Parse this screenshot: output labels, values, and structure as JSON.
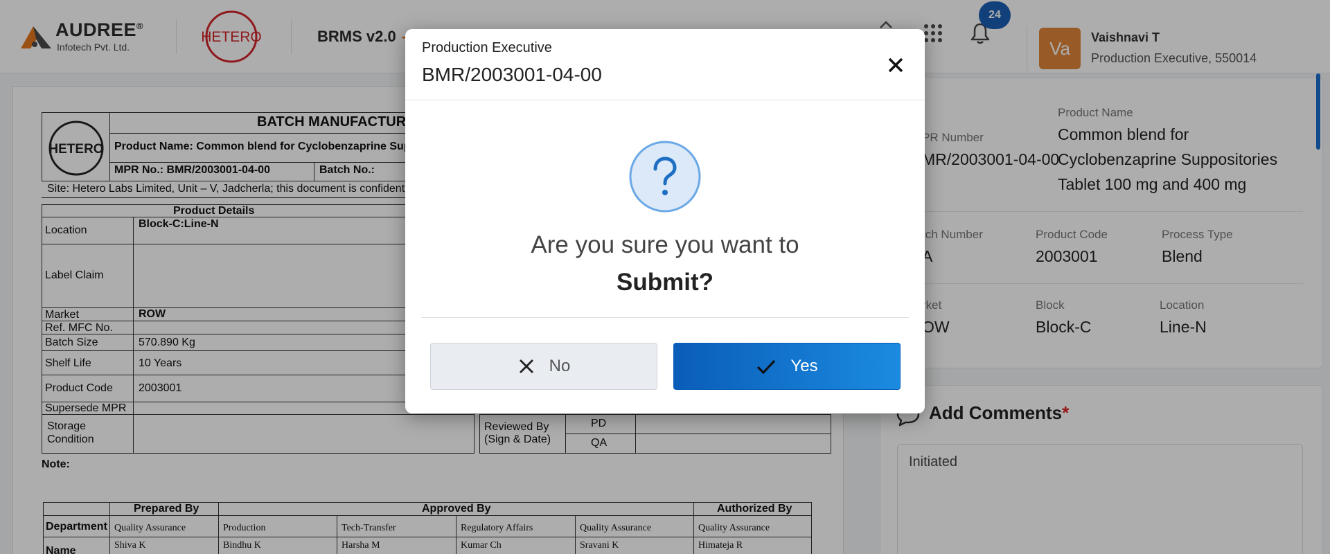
{
  "header": {
    "company_name": "AUDREE",
    "company_reg": "®",
    "company_sub": "Infotech Pvt. Ltd.",
    "client_logo_text": "HETERO",
    "app_title": "BRMS v2.0",
    "app_title_suffix": "-",
    "notification_count": "24",
    "user": {
      "initials": "Va",
      "name": "Vaishnavi T",
      "role": "Production Executive, 550014"
    },
    "icons": [
      "chevron-up-icon",
      "apps-grid-icon",
      "bell-icon"
    ]
  },
  "document": {
    "logo_text": "HETERO",
    "title": "BATCH MANUFACTUR",
    "product_name": "Product Name: Common blend for Cyclobenzaprine Sup",
    "mpr_no": "MPR No.: BMR/2003001-04-00",
    "batch_no": "Batch No.:",
    "site": "Site: Hetero Labs Limited, Unit – V, Jadcherla; this document is confidentia",
    "details_heading": "Product Details",
    "rows": [
      {
        "label": "Location",
        "value": "Block-C:Line-N"
      },
      {
        "label": "Label Claim",
        "value": ""
      },
      {
        "label": "Market",
        "value": "ROW"
      },
      {
        "label": "Ref. MFC No.",
        "value": ""
      },
      {
        "label": "Batch Size",
        "value": "570.890 Kg"
      },
      {
        "label": "Shelf Life",
        "value": "10 Years"
      },
      {
        "label": "Product Code",
        "value": "2003001"
      },
      {
        "label": "Supersede MPR",
        "value": ""
      },
      {
        "label": "Storage",
        "value": ""
      },
      {
        "label": "Condition",
        "value": ""
      }
    ],
    "reviewed_by_line1": "Reviewed By",
    "reviewed_by_line2": "(Sign & Date)",
    "review_pd": "PD",
    "review_qa": "QA",
    "note": "Note:",
    "approvals": {
      "prepared_by": "Prepared By",
      "approved_by": "Approved By",
      "authorized_by": "Authorized By",
      "department_label": "Department",
      "name_label": "Name",
      "departments": [
        "Quality Assurance",
        "Production",
        "Tech-Transfer",
        "Regulatory Affairs",
        "Quality Assurance",
        "Quality Assurance"
      ],
      "names": [
        "Shiva K",
        "Bindhu K",
        "Harsha M",
        "Kumar Ch",
        "Sravani K",
        "Himateja R"
      ]
    }
  },
  "panel": {
    "mpr_label": "PR Number",
    "mpr_value": "MR/2003001-04-00",
    "product_name_label": "Product Name",
    "product_name_lines": [
      "Common blend for",
      "Cyclobenzaprine Suppositories",
      "Tablet 100 mg and 400 mg"
    ],
    "batch_label": "tch Number",
    "batch_value": "A",
    "product_code_label": "Product Code",
    "product_code_value": "2003001",
    "process_type_label": "Process Type",
    "process_type_value": "Blend",
    "market_label": "rket",
    "market_value": "OW",
    "block_label": "Block",
    "block_value": "Block-C",
    "location_label": "Location",
    "location_value": "Line-N"
  },
  "comments": {
    "title": "Add Comments",
    "required_mark": "*",
    "value": "Initiated"
  },
  "modal": {
    "role": "Production Executive",
    "record_id": "BMR/2003001-04-00",
    "question_line1": "Are you sure you want to",
    "question_line2": "Submit?",
    "no_label": "No",
    "yes_label": "Yes",
    "accent": "#0a5db8"
  }
}
